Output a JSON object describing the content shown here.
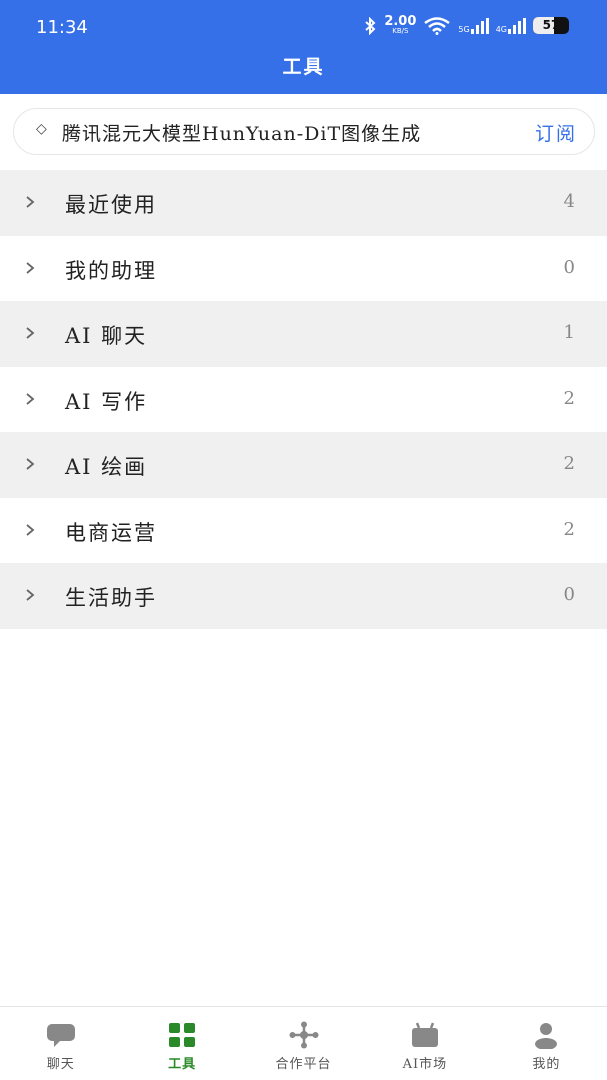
{
  "status_bar": {
    "time": "11:34",
    "net_speed": "2.00",
    "net_unit": "KB/S",
    "sig1_label": "5G",
    "sig2_label": "4G",
    "battery_level": "57",
    "battery_fraction": 0.57
  },
  "header": {
    "title": "工具"
  },
  "banner": {
    "text": "腾讯混元大模型HunYuan-DiT图像生成",
    "subscribe_label": "订阅"
  },
  "categories": [
    {
      "label": "最近使用",
      "count": "4"
    },
    {
      "label": "我的助理",
      "count": "0"
    },
    {
      "label": "AI 聊天",
      "count": "1"
    },
    {
      "label": "AI 写作",
      "count": "2"
    },
    {
      "label": "AI 绘画",
      "count": "2"
    },
    {
      "label": "电商运营",
      "count": "2"
    },
    {
      "label": "生活助手",
      "count": "0"
    }
  ],
  "tabs": [
    {
      "label": "聊天",
      "icon": "chat-bubble-icon",
      "active": false
    },
    {
      "label": "工具",
      "icon": "grid-icon",
      "active": true
    },
    {
      "label": "合作平台",
      "icon": "network-icon",
      "active": false
    },
    {
      "label": "AI市场",
      "icon": "market-bag-icon",
      "active": false
    },
    {
      "label": "我的",
      "icon": "person-icon",
      "active": false
    }
  ],
  "colors": {
    "header_bg": "#3570e8",
    "accent_blue": "#3570e8",
    "active_tab": "#2a8a2a",
    "inactive_icon": "#888888"
  }
}
